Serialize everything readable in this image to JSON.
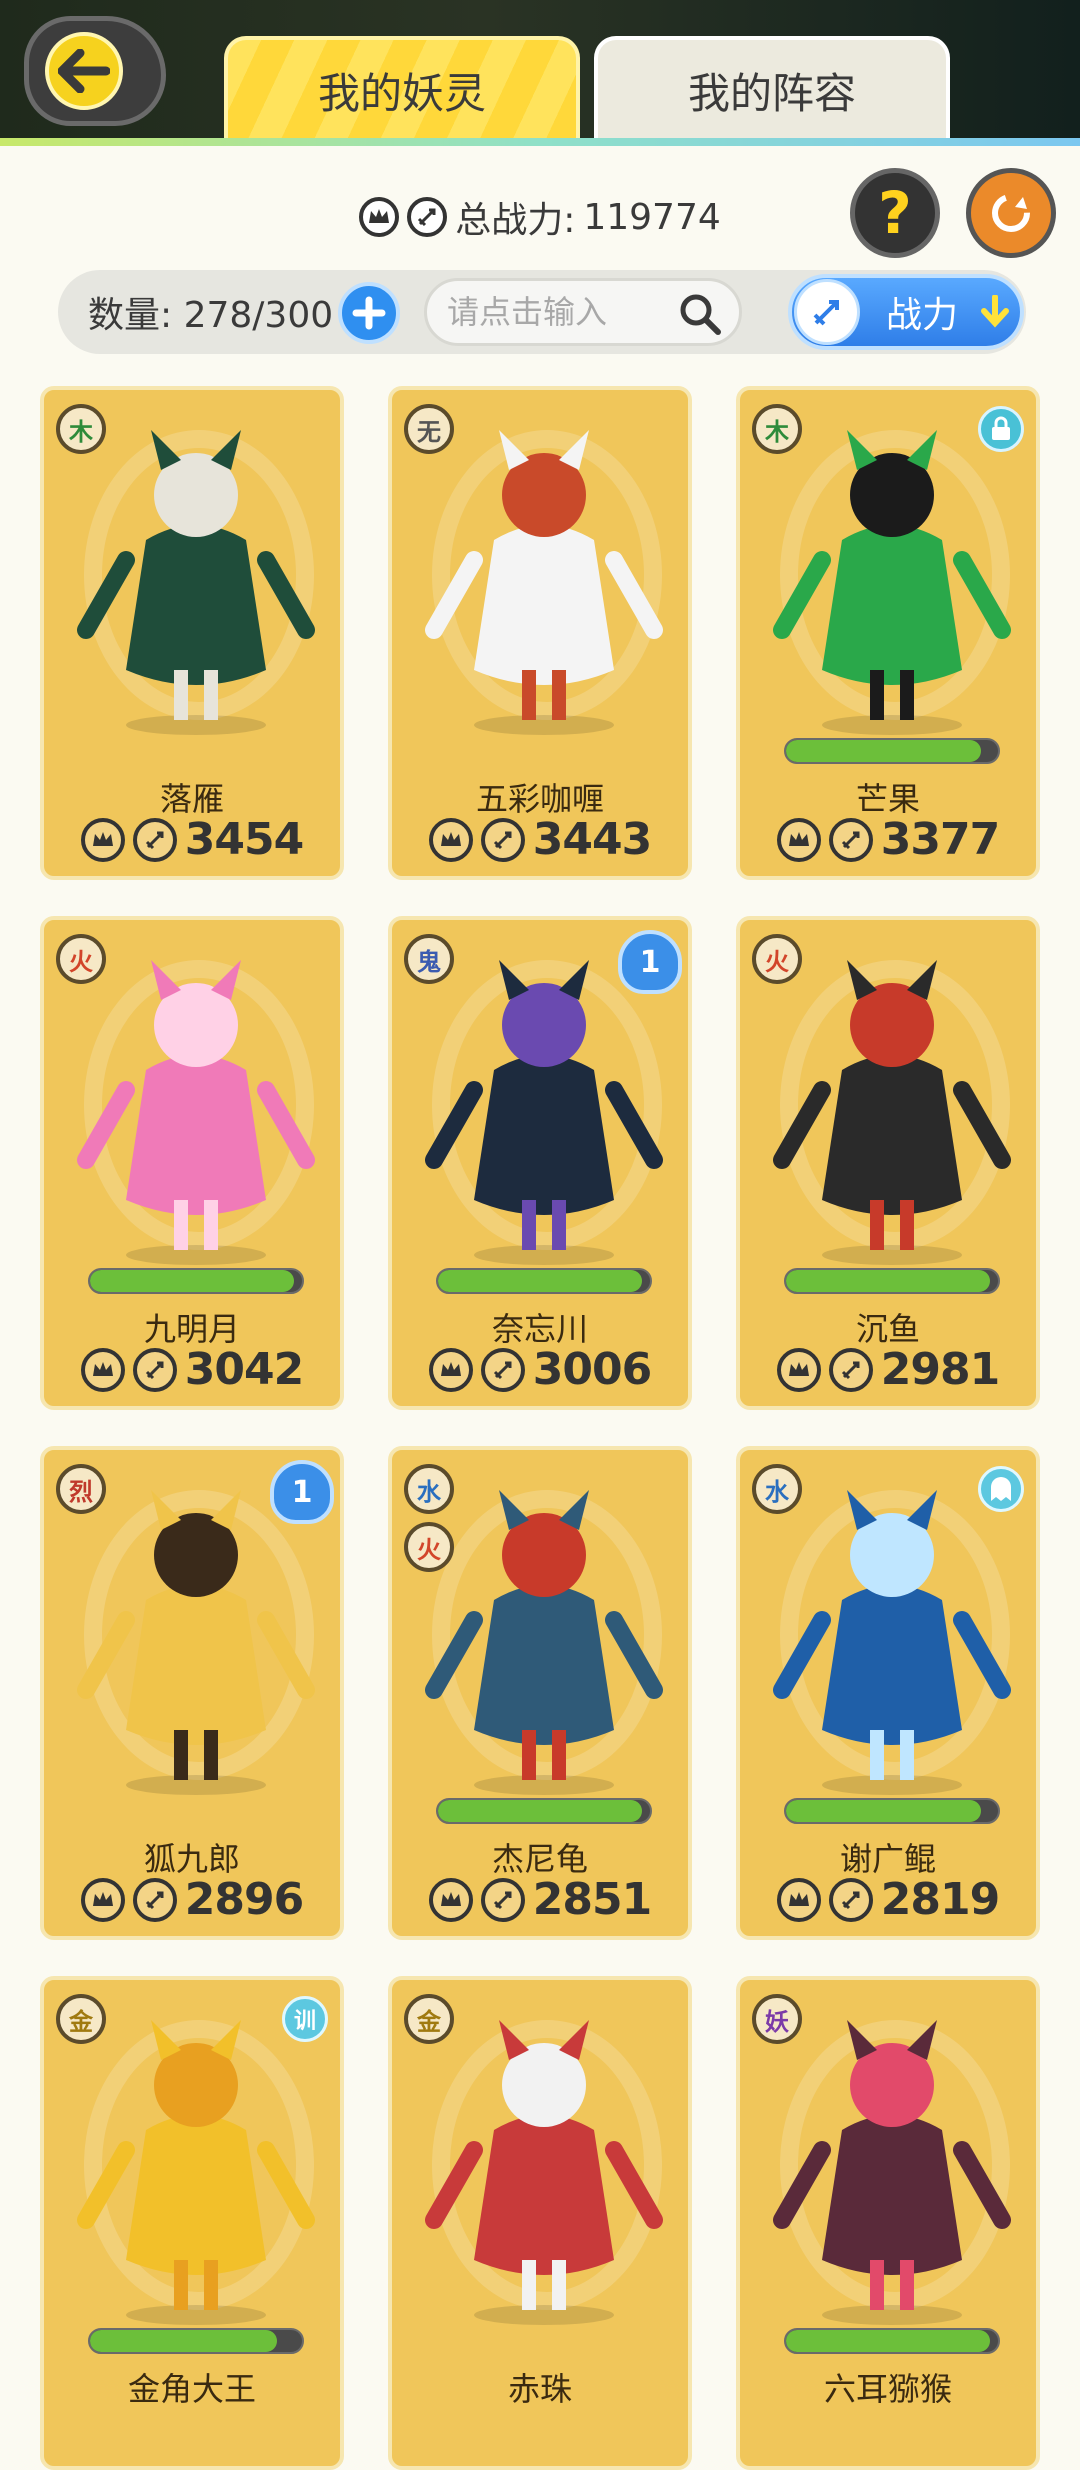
{
  "tabs": [
    {
      "label": "我的妖灵",
      "active": true
    },
    {
      "label": "我的阵容",
      "active": false
    }
  ],
  "stats": {
    "total_power_label": "总战力:",
    "total_power_value": "119774",
    "count_label": "数量: 278/300"
  },
  "search": {
    "placeholder": "请点击输入"
  },
  "sort": {
    "label": "战力"
  },
  "colors": {
    "accent_blue": "#2f7ee8",
    "card_gold": "#f0c65a",
    "bar_green": "#6cbf3a",
    "tab_yellow": "#ffd83a"
  },
  "cards": [
    {
      "name": "落雁",
      "power": "3454",
      "element": "木",
      "element_color": "#2e8b3a",
      "bar": null,
      "badge": null
    },
    {
      "name": "五彩咖喱",
      "power": "3443",
      "element": "无",
      "element_color": "#555555",
      "bar": null,
      "badge": null
    },
    {
      "name": "芒果",
      "power": "3377",
      "element": "木",
      "element_color": "#2e8b3a",
      "bar": 0.92,
      "badge": "lock"
    },
    {
      "name": "九明月",
      "power": "3042",
      "element": "火",
      "element_color": "#d2452a",
      "bar": 0.96,
      "badge": null
    },
    {
      "name": "奈忘川",
      "power": "3006",
      "element": "鬼",
      "element_color": "#3b5bb0",
      "bar": 0.96,
      "badge": "1"
    },
    {
      "name": "沉鱼",
      "power": "2981",
      "element": "火",
      "element_color": "#d2452a",
      "bar": 0.96,
      "badge": null
    },
    {
      "name": "狐九郎",
      "power": "2896",
      "element": "烈",
      "element_color": "#c0392b",
      "bar": null,
      "badge": "1"
    },
    {
      "name": "杰尼龟",
      "power": "2851",
      "element": "水",
      "element2": "火",
      "element_color": "#2a6fbf",
      "element2_color": "#d2452a",
      "bar": 0.96,
      "badge": null
    },
    {
      "name": "谢广鲲",
      "power": "2819",
      "element": "水",
      "element_color": "#2a6fbf",
      "bar": 0.92,
      "badge": "ghost"
    },
    {
      "name": "金角大王",
      "power": "",
      "element": "金",
      "element_color": "#a07a10",
      "bar": 0.88,
      "badge": "训"
    },
    {
      "name": "赤珠",
      "power": "",
      "element": "金",
      "element_color": "#a07a10",
      "bar": null,
      "badge": null
    },
    {
      "name": "六耳猕猴",
      "power": "",
      "element": "妖",
      "element_color": "#7b3aa8",
      "bar": 0.96,
      "badge": null
    }
  ]
}
